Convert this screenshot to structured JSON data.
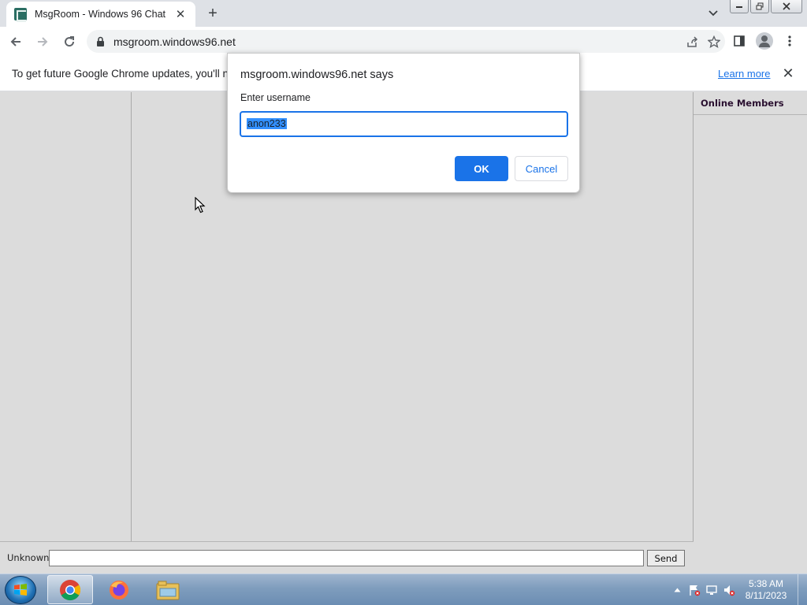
{
  "browser": {
    "tab_title": "MsgRoom - Windows 96 Chat",
    "url": "msgroom.windows96.net"
  },
  "infobar": {
    "message": "To get future Google Chrome updates, you'll ne",
    "learn_more": "Learn more"
  },
  "dialog": {
    "title": "msgroom.windows96.net says",
    "prompt": "Enter username",
    "input_value": "anon233",
    "ok_label": "OK",
    "cancel_label": "Cancel"
  },
  "chat": {
    "members_header": "Online Members",
    "user_label": "Unknown",
    "message_value": "",
    "send_label": "Send"
  },
  "taskbar": {
    "time": "5:38 AM",
    "date": "8/11/2023",
    "pinned": [
      "chrome-icon",
      "firefox-icon",
      "file-explorer-icon"
    ]
  },
  "colors": {
    "accent": "#1a73e8",
    "page_bg": "#dcdcdc",
    "members_header_text": "#2a1030"
  }
}
